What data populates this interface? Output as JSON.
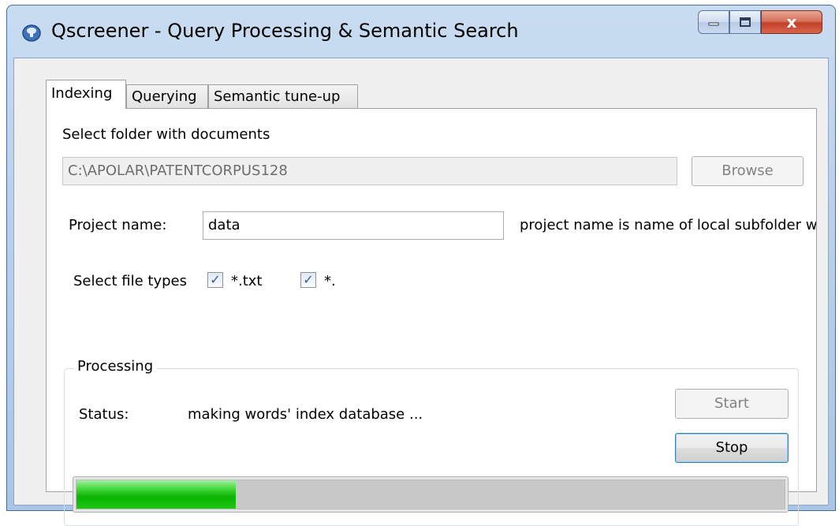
{
  "window": {
    "title": "Qscreener - Query Processing & Semantic Search",
    "caption_buttons": {
      "minimize": "minimize-icon",
      "maximize": "maximize-icon",
      "close_label": "x"
    }
  },
  "tabs": [
    {
      "label": "Indexing",
      "active": true
    },
    {
      "label": "Querying",
      "active": false
    },
    {
      "label": "Semantic tune-up",
      "active": false
    }
  ],
  "indexing": {
    "folder_label": "Select folder with documents",
    "folder_path": "C:\\APOLAR\\PATENTCORPUS128",
    "browse_label": "Browse",
    "project_label": "Project name:",
    "project_value": "data",
    "project_hint": "project name is name of local subfolder w",
    "file_types_label": "Select file types",
    "file_types": [
      {
        "label": "*.txt",
        "checked": true
      },
      {
        "label": "*.",
        "checked": true
      }
    ],
    "processing": {
      "group_title": "Processing",
      "status_label": "Status:",
      "status_value": "making words' index database ...",
      "start_label": "Start",
      "stop_label": "Stop",
      "progress_percent": 22.5
    }
  },
  "colors": {
    "progress_green": "#0db202",
    "client_bg": "#f0f0f0",
    "titlebar": "#b9d1ec"
  }
}
